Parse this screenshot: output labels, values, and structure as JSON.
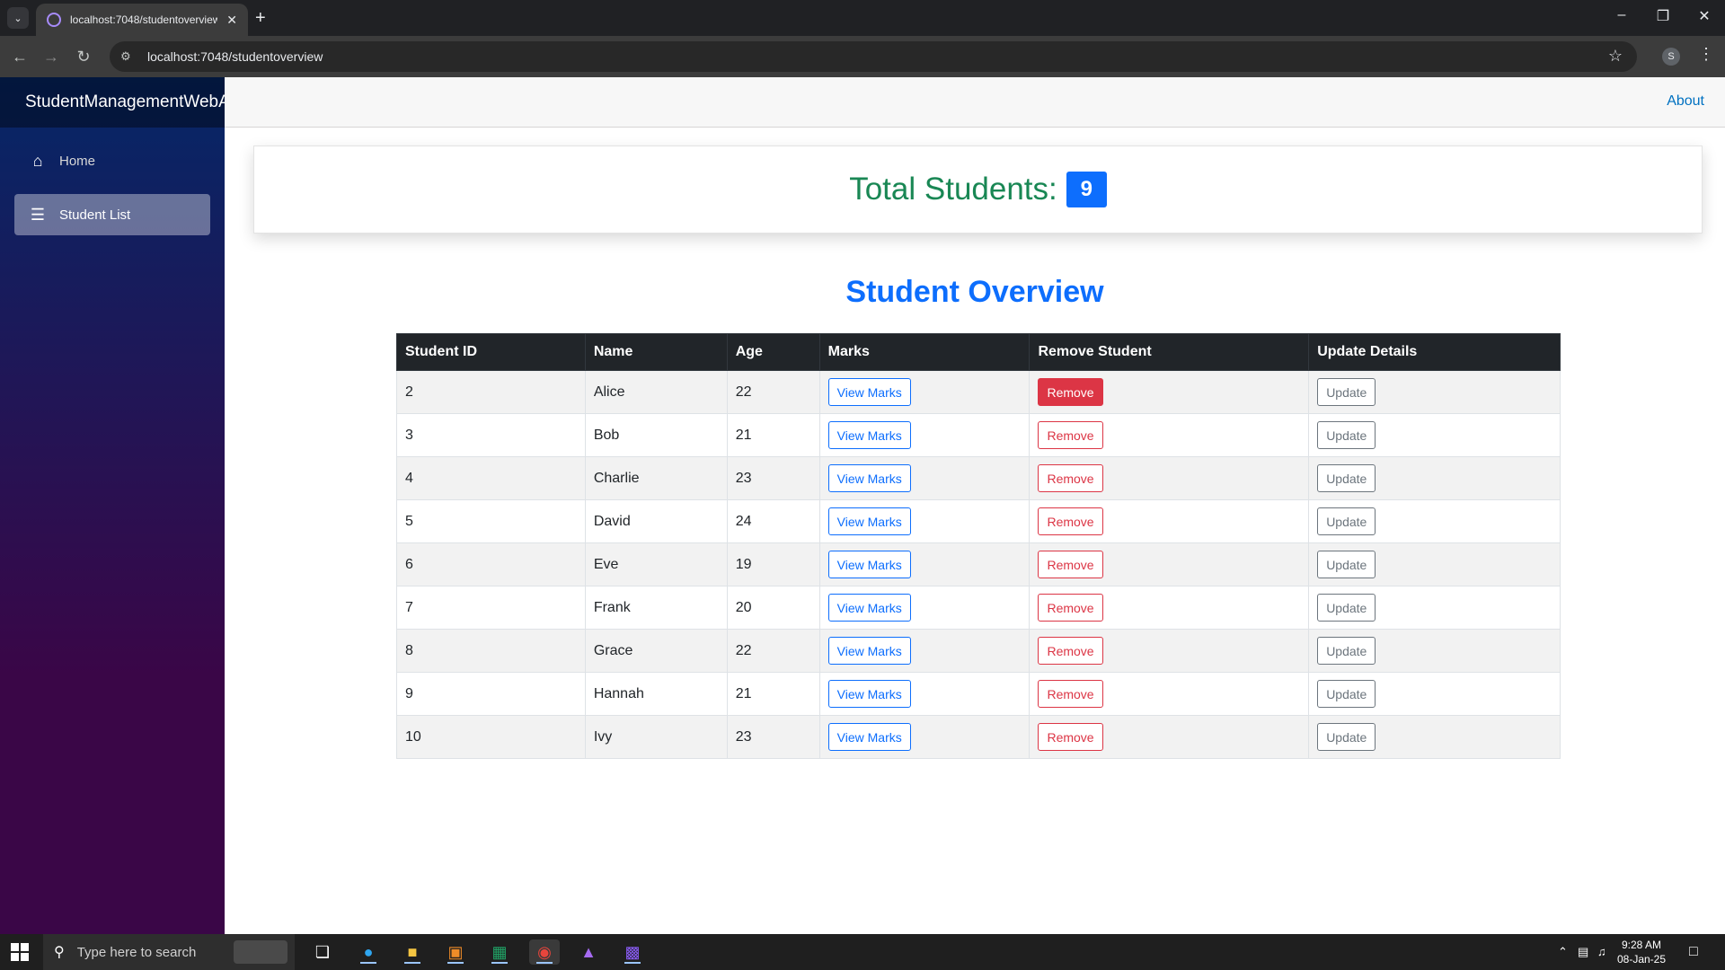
{
  "browser": {
    "tab_title": "localhost:7048/studentoverview",
    "url": "localhost:7048/studentoverview",
    "profile_initial": "S"
  },
  "app": {
    "brand": "StudentManagementWebAp",
    "nav": [
      {
        "label": "Home",
        "icon": "home-icon"
      },
      {
        "label": "Student List",
        "icon": "list-icon",
        "active": true
      }
    ],
    "top_link": "About"
  },
  "summary": {
    "label": "Total Students:",
    "count": "9"
  },
  "overview": {
    "title": "Student Overview",
    "columns": [
      "Student ID",
      "Name",
      "Age",
      "Marks",
      "Remove Student",
      "Update Details"
    ],
    "buttons": {
      "view": "View Marks",
      "remove": "Remove",
      "update": "Update"
    },
    "rows": [
      {
        "id": "2",
        "name": "Alice",
        "age": "22"
      },
      {
        "id": "3",
        "name": "Bob",
        "age": "21"
      },
      {
        "id": "4",
        "name": "Charlie",
        "age": "23"
      },
      {
        "id": "5",
        "name": "David",
        "age": "24"
      },
      {
        "id": "6",
        "name": "Eve",
        "age": "19"
      },
      {
        "id": "7",
        "name": "Frank",
        "age": "20"
      },
      {
        "id": "8",
        "name": "Grace",
        "age": "22"
      },
      {
        "id": "9",
        "name": "Hannah",
        "age": "21"
      },
      {
        "id": "10",
        "name": "Ivy",
        "age": "23"
      }
    ]
  },
  "taskbar": {
    "search_placeholder": "Type here to search",
    "time": "9:28 AM",
    "date": "08-Jan-25"
  },
  "colors": {
    "accent": "#0d6efd",
    "success": "#198754",
    "danger": "#dc3545",
    "secondary": "#6c757d",
    "table_header": "#212529"
  }
}
